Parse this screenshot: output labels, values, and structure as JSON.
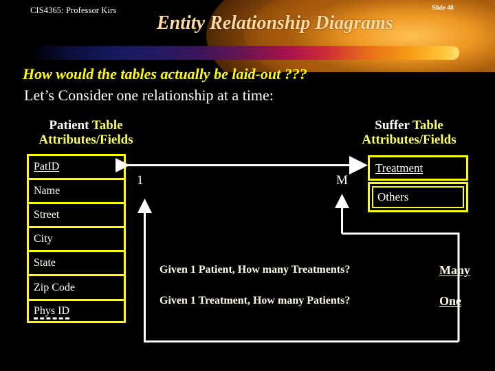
{
  "header": {
    "course": "CIS4365: Professor Kirs",
    "slide_number": "Slide 48",
    "title": "Entity Relationship Diagrams",
    "accent_yellow": "#ffff00",
    "accent_gold": "#ffd9a0",
    "background": "#000000"
  },
  "subtitle": {
    "question": "How would the tables actually be laid-out  ???",
    "instruction": "Let’s Consider one relationship at a time:"
  },
  "patient_table": {
    "caption_name": "Patient",
    "caption_table_word": "Table",
    "caption_line2": "Attributes/Fields",
    "fields": [
      {
        "name": "PatID",
        "key": "primary"
      },
      {
        "name": "Name",
        "key": "none"
      },
      {
        "name": "Street",
        "key": "none"
      },
      {
        "name": "City",
        "key": "none"
      },
      {
        "name": "State",
        "key": "none"
      },
      {
        "name": "Zip Code",
        "key": "none"
      },
      {
        "name": "Phys ID",
        "key": "foreign"
      }
    ]
  },
  "suffer_table": {
    "caption_name": "Suffer",
    "caption_table_word": "Table",
    "caption_line2": "Attributes/Fields",
    "fields": [
      {
        "name": "Treatment",
        "key": "primary"
      },
      {
        "name": "Others",
        "key": "none"
      }
    ]
  },
  "relationship": {
    "left_cardinality": "1",
    "right_cardinality": "M"
  },
  "questions": [
    {
      "text": "Given 1 Patient, How many Treatments?",
      "answer": "Many"
    },
    {
      "text": "Given 1 Treatment, How many Patients?",
      "answer": "One"
    }
  ]
}
